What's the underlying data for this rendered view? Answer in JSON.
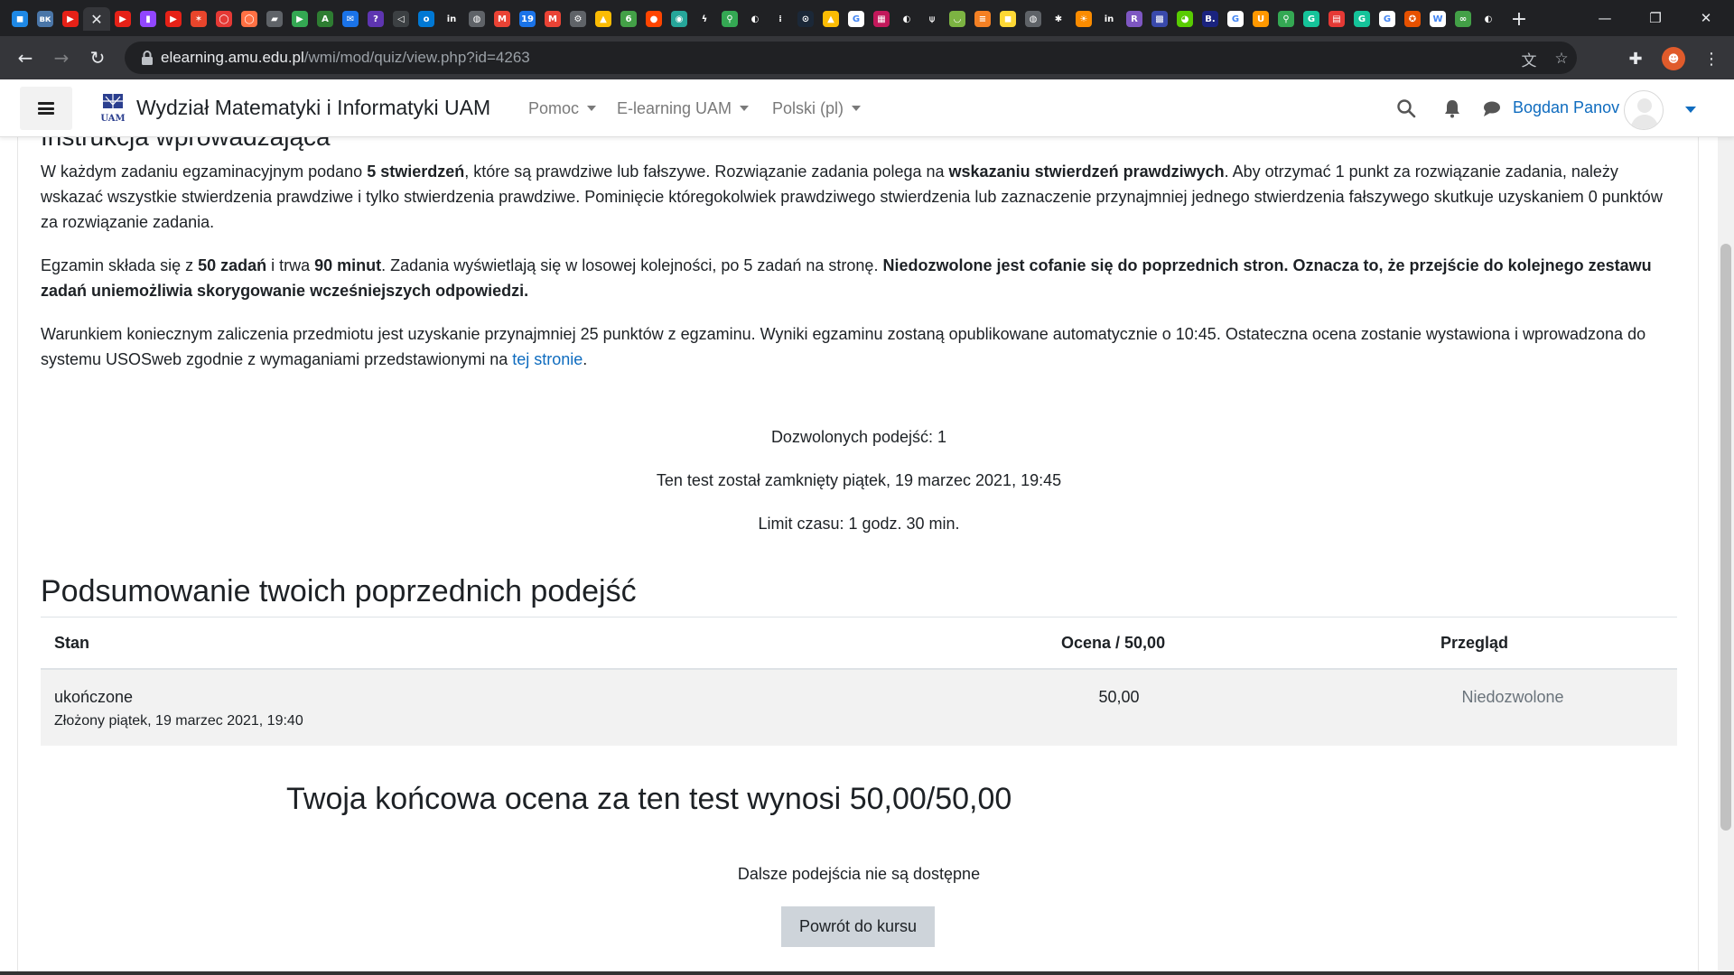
{
  "browser": {
    "url_host": "elearning.amu.edu.pl",
    "url_path": "/wmi/mod/quiz/view.php?id=4263",
    "new_tab_label": "+",
    "tab_favicons": [
      {
        "icon": "messenger-icon",
        "color": "#1e88e5",
        "glyph": "◼"
      },
      {
        "icon": "vk-icon",
        "color": "#4a76a8",
        "glyph": "вк"
      },
      {
        "icon": "youtube-icon",
        "color": "#e62117",
        "glyph": "▶"
      },
      {
        "icon": "close-tab-icon",
        "color": "#35363a",
        "glyph": "✕"
      },
      {
        "icon": "youtube-icon",
        "color": "#e62117",
        "glyph": "▶"
      },
      {
        "icon": "twitch-icon",
        "color": "#9146ff",
        "glyph": "▮"
      },
      {
        "icon": "youtube-icon",
        "color": "#e62117",
        "glyph": "▶"
      },
      {
        "icon": "flame-icon",
        "color": "#e8452c",
        "glyph": "✶"
      },
      {
        "icon": "circle-icon",
        "color": "#e53935",
        "glyph": "◯"
      },
      {
        "icon": "circle-icon",
        "color": "#ff7043",
        "glyph": "◯"
      },
      {
        "icon": "chat-icon",
        "color": "#5f6368",
        "glyph": "▰"
      },
      {
        "icon": "play-store-icon",
        "color": "#34a853",
        "glyph": "▶"
      },
      {
        "icon": "font-icon",
        "color": "#2e7d32",
        "glyph": "A"
      },
      {
        "icon": "mail-icon",
        "color": "#1a73e8",
        "glyph": "✉"
      },
      {
        "icon": "question-icon",
        "color": "#5e35b1",
        "glyph": "?"
      },
      {
        "icon": "back-icon",
        "color": "#3c4043",
        "glyph": "◁"
      },
      {
        "icon": "outlook-icon",
        "color": "#0078d4",
        "glyph": "o"
      },
      {
        "icon": "in-icon",
        "color": "#202124",
        "glyph": "in"
      },
      {
        "icon": "globe-icon",
        "color": "#5f6368",
        "glyph": "◍"
      },
      {
        "icon": "gmail-icon",
        "color": "#ea4335",
        "glyph": "M"
      },
      {
        "icon": "calendar-icon",
        "color": "#1a73e8",
        "glyph": "19"
      },
      {
        "icon": "gmail-icon",
        "color": "#ea4335",
        "glyph": "M"
      },
      {
        "icon": "gear-icon",
        "color": "#5f6368",
        "glyph": "⚙"
      },
      {
        "icon": "drive-icon",
        "color": "#fbbc04",
        "glyph": "▲"
      },
      {
        "icon": "leaf-icon",
        "color": "#43a047",
        "glyph": "6"
      },
      {
        "icon": "reddit-icon",
        "color": "#ff4500",
        "glyph": "●"
      },
      {
        "icon": "chat-bubble-icon",
        "color": "#26a69a",
        "glyph": "◉"
      },
      {
        "icon": "bolt-icon",
        "color": "#202124",
        "glyph": "ϟ"
      },
      {
        "icon": "maps-icon",
        "color": "#34a853",
        "glyph": "⚲"
      },
      {
        "icon": "github-icon",
        "color": "#202124",
        "glyph": "◐"
      },
      {
        "icon": "dots-icon",
        "color": "#202124",
        "glyph": "⁞"
      },
      {
        "icon": "steam-icon",
        "color": "#1b2838",
        "glyph": "⊙"
      },
      {
        "icon": "drive-icon",
        "color": "#fbbc04",
        "glyph": "▲"
      },
      {
        "icon": "google-icon",
        "color": "#ffffff",
        "glyph": "G"
      },
      {
        "icon": "grid-icon",
        "color": "#c2185b",
        "glyph": "▦"
      },
      {
        "icon": "github-icon",
        "color": "#202124",
        "glyph": "◐"
      },
      {
        "icon": "tree-icon",
        "color": "#202124",
        "glyph": "⍦"
      },
      {
        "icon": "bowl-icon",
        "color": "#7cb342",
        "glyph": "◡"
      },
      {
        "icon": "stack-icon",
        "color": "#f48024",
        "glyph": "≡"
      },
      {
        "icon": "note-icon",
        "color": "#fdd835",
        "glyph": "◼"
      },
      {
        "icon": "globe-icon",
        "color": "#5f6368",
        "glyph": "◍"
      },
      {
        "icon": "sparkle-icon",
        "color": "#202124",
        "glyph": "✱"
      },
      {
        "icon": "sun-icon",
        "color": "#fb8c00",
        "glyph": "☀"
      },
      {
        "icon": "in-icon",
        "color": "#202124",
        "glyph": "in"
      },
      {
        "icon": "r-icon",
        "color": "#7e57c2",
        "glyph": "R"
      },
      {
        "icon": "qr-icon",
        "color": "#3949ab",
        "glyph": "▩"
      },
      {
        "icon": "duolingo-icon",
        "color": "#58cc02",
        "glyph": "◕"
      },
      {
        "icon": "b-icon",
        "color": "#1a237e",
        "glyph": "B."
      },
      {
        "icon": "google-icon",
        "color": "#ffffff",
        "glyph": "G"
      },
      {
        "icon": "u-icon",
        "color": "#ff9800",
        "glyph": "U"
      },
      {
        "icon": "maps-icon",
        "color": "#34a853",
        "glyph": "⚲"
      },
      {
        "icon": "grammarly-icon",
        "color": "#15c39a",
        "glyph": "G"
      },
      {
        "icon": "calendar-icon",
        "color": "#e53935",
        "glyph": "▤"
      },
      {
        "icon": "grammarly-icon",
        "color": "#15c39a",
        "glyph": "G"
      },
      {
        "icon": "google-icon",
        "color": "#ffffff",
        "glyph": "G"
      },
      {
        "icon": "badge-icon",
        "color": "#e65100",
        "glyph": "✪"
      },
      {
        "icon": "wikipedia-icon",
        "color": "#ffffff",
        "glyph": "W"
      },
      {
        "icon": "infinity-icon",
        "color": "#43a047",
        "glyph": "∞"
      },
      {
        "icon": "github-icon",
        "color": "#202124",
        "glyph": "◐"
      }
    ]
  },
  "site": {
    "title": "Wydział Matematyki i Informatyki UAM",
    "menu": [
      {
        "label": "Pomoc"
      },
      {
        "label": "E-learning UAM"
      },
      {
        "label": "Polski ‎(pl)‎"
      }
    ],
    "user_name": "Bogdan Panov",
    "accent": "#0f6cbf"
  },
  "intro": {
    "heading": "Instrukcja wprowadzająca",
    "p1": {
      "t1": "W każdym zadaniu egzaminacyjnym podano ",
      "b1": "5 stwierdzeń",
      "t2": ", które są prawdziwe lub fałszywe. Rozwiązanie zadania polega na ",
      "b2": "wskazaniu stwierdzeń prawdziwych",
      "t3": ". Aby otrzymać 1 punkt za rozwiązanie zadania, należy wskazać wszystkie stwierdzenia prawdziwe i tylko stwierdzenia prawdziwe. Pominięcie któregokolwiek prawdziwego stwierdzenia lub zaznaczenie przynajmniej jednego stwierdzenia fałszywego skutkuje uzyskaniem 0 punktów za rozwiązanie zadania."
    },
    "p2": {
      "t1": "Egzamin składa się z ",
      "b1": "50 zadań",
      "t2": " i trwa ",
      "b2": "90 minut",
      "t3": ". Zadania wyświetlają się w losowej kolejności, po 5 zadań na stronę. ",
      "b3": "Niedozwolone jest cofanie się do poprzednich stron. Oznacza to, że przejście do kolejnego zestawu zadań uniemożliwia skorygowanie wcześniejszych odpowiedzi."
    },
    "p3": {
      "t1": "Warunkiem koniecznym zaliczenia przedmiotu jest uzyskanie przynajmniej 25 punktów z egzaminu. Wyniki egzaminu zostaną opublikowane automatycznie o 10:45. Ostateczna ocena zostanie wystawiona i wprowadzona do systemu USOSweb zgodnie z wymaganiami przedstawionymi na ",
      "link": "tej stronie",
      "t2": "."
    }
  },
  "quiz_info": {
    "attempts_allowed": "Dozwolonych podejść: 1",
    "closed": "Ten test został zamknięty piątek, 19 marzec 2021, 19:45",
    "time_limit": "Limit czasu: 1 godz. 30 min."
  },
  "summary": {
    "heading": "Podsumowanie twoich poprzednich podejść",
    "columns": [
      "Stan",
      "Ocena / 50,00",
      "Przegląd"
    ],
    "rows": [
      {
        "state": "ukończone",
        "submitted": "Złożony piątek, 19 marzec 2021, 19:40",
        "grade": "50,00",
        "review": "Niedozwolone"
      }
    ]
  },
  "final": {
    "text": "Twoja końcowa ocena za ten test wynosi",
    "grade": "50,00/50,00",
    "no_more": "Dalsze podejścia nie są dostępne",
    "back_button": "Powrót do kursu"
  }
}
